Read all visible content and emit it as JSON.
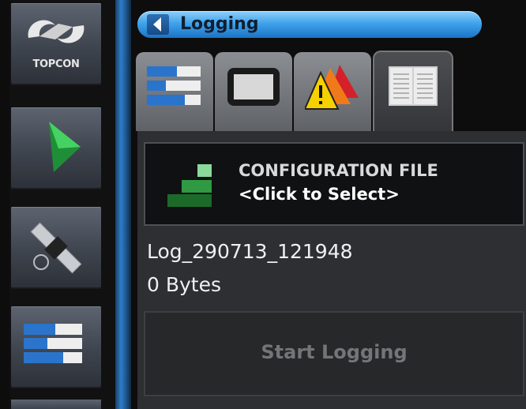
{
  "header": {
    "title": "Logging"
  },
  "sidebar": {
    "logo_text": "TOPCON",
    "items": [
      {
        "icon": "topcon-logo-icon"
      },
      {
        "icon": "guidance-arrow-icon"
      },
      {
        "icon": "gps-satellite-icon"
      },
      {
        "icon": "settings-bars-icon"
      }
    ]
  },
  "tabs": [
    {
      "icon": "status-bars-icon"
    },
    {
      "icon": "display-icon"
    },
    {
      "icon": "alarms-icon"
    },
    {
      "icon": "log-book-icon",
      "active": true
    }
  ],
  "config": {
    "title": "CONFIGURATION FILE",
    "value": "<Click to Select>"
  },
  "file": {
    "name": "Log_290713_121948",
    "size": "0 Bytes"
  },
  "start_button": {
    "label": "Start Logging",
    "enabled": false
  },
  "colors": {
    "accent": "#2e7cc9",
    "titlebar": "#41a3ec",
    "guide_green": "#2eb84a",
    "alarm_orange": "#f07a1a"
  }
}
